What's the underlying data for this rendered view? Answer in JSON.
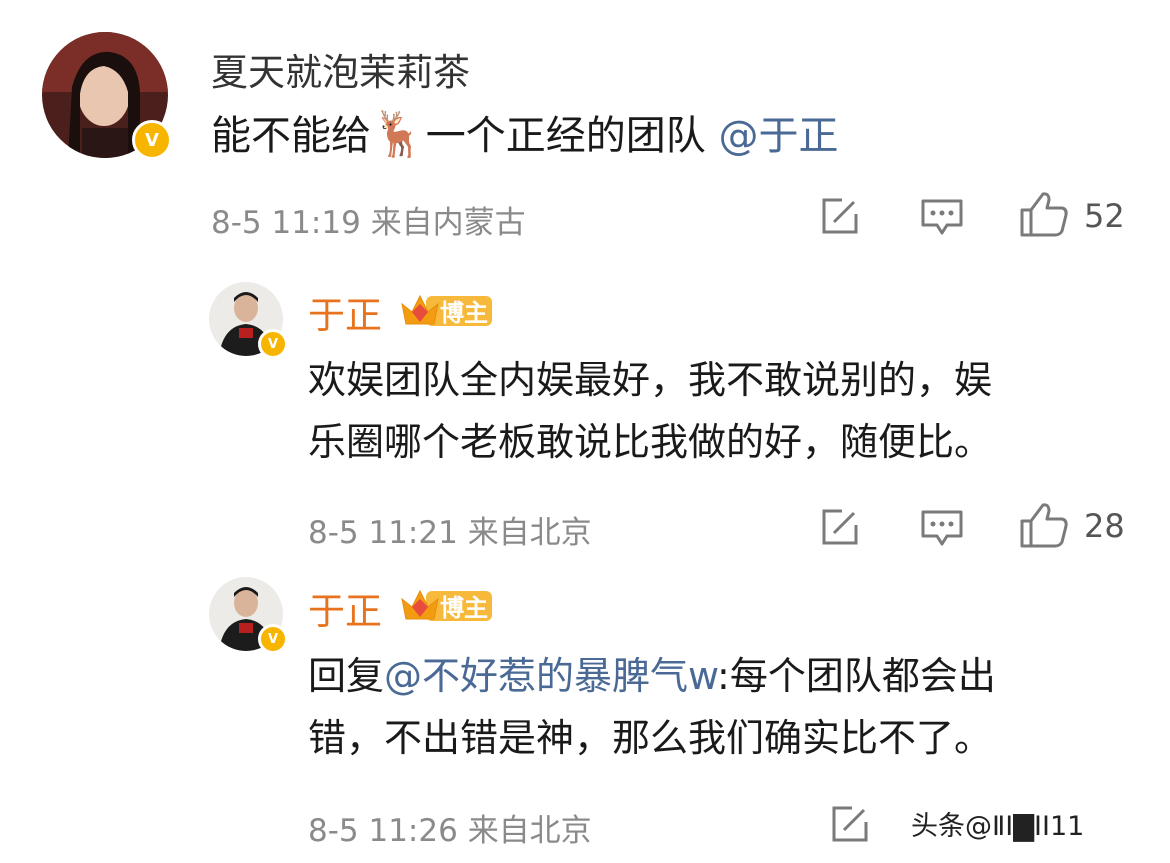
{
  "comments": [
    {
      "user_name": "夏天就泡茉莉茶",
      "verified_badge": "V",
      "text_before": "能不能给",
      "emoji": "🦌",
      "text_after": "一个正经的团队 ",
      "mention": "@于正",
      "time": "8-5 11:19",
      "location": "来自内蒙古",
      "likes": "52"
    },
    {
      "user_name": "于正",
      "verified_badge": "V",
      "blogger_label": "博主",
      "text_line1": "欢娱团队全内娱最好，我不敢说别的，娱",
      "text_line2": "乐圈哪个老板敢说比我做的好，随便比。",
      "time": "8-5 11:21",
      "location": "来自北京",
      "likes": "28"
    },
    {
      "user_name": "于正",
      "verified_badge": "V",
      "blogger_label": "博主",
      "reply_prefix": "回复",
      "mention": "@不好惹的暴脾气w",
      "text_line1_after": ":每个团队都会出",
      "text_line2": "错，不出错是神，那么我们确实比不了。",
      "time": "8-5 11:26",
      "location": "来自北京"
    }
  ],
  "watermark": "头条@ⅡⅠ▇ⅠⅠ11",
  "colors": {
    "mention": "#4a6a95",
    "blogger_name": "#e8731f",
    "verified_badge": "#f7b500",
    "meta_text": "#8a8a8a"
  },
  "icons": [
    "edit-icon",
    "comment-icon",
    "thumbs-up-icon"
  ]
}
